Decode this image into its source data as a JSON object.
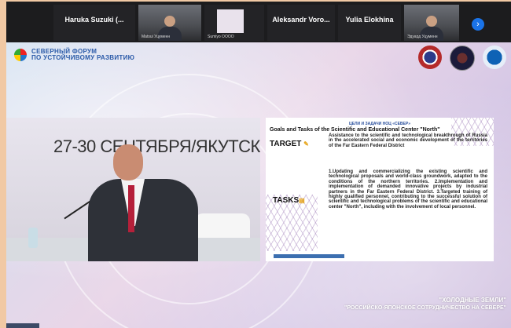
{
  "participants": [
    {
      "name": "Haruka Suzuki (...",
      "sub": "",
      "video": false
    },
    {
      "name": "",
      "sub": "Matsui Уцуменн",
      "video": true
    },
    {
      "name": "",
      "sub": "Sumiyo OOOO",
      "video": false
    },
    {
      "name": "Aleksandr Voro...",
      "sub": "",
      "video": false
    },
    {
      "name": "Yulia Elokhina",
      "sub": "",
      "video": false
    },
    {
      "name": "",
      "sub": "Эдуард Уцуменн",
      "video": true
    }
  ],
  "strip": {
    "next_icon": "chevron-right-icon",
    "next_glyph": "›"
  },
  "forum": {
    "line1": "СЕВЕРНЫЙ ФОРУМ",
    "line2": "ПО УСТОЙЧИВОМУ РАЗВИТИЮ"
  },
  "banner_date": "27-30 СЕНТЯБРЯ/ЯКУТСК",
  "slide": {
    "title_ru": "ЦЕЛИ И ЗАДАЧИ НОЦ «СЕВЕР»",
    "title_en": "Goals and Tasks of the Scientific and Educational Center \"North\"",
    "target_label": "TARGET",
    "target_text": "Assistance to the scientific and technological breakthrough of Russia in the accelerated social and economic development of the territories of the Far Eastern Federal District",
    "tasks_label": "TASKS",
    "tasks_text": "1.Updating and commercializing the existing scientific and technological proposals and world-class groundwork, adapted to the conditions of the northern territories. 2.Implementation and implementation of demanded innovative projects by industrial partners in the Far Eastern Federal District. 3.Targeted training of highly qualified personnel, contributing to the successful solution of scientific and technological problems of the scientific and educational center \"North\", including with the involvement of local personnel."
  },
  "caption": {
    "line1": "\"ХОЛОДНЫЕ ЗЕМЛИ\"",
    "line2": "\"РОССИЙСКО-ЯПОНСКОЕ СОТРУДНИЧЕСТВО НА СЕВЕРЕ\""
  },
  "colors": {
    "accent": "#1a73e8",
    "forum_blue": "#2a5aa8",
    "tie": "#b5203a"
  }
}
